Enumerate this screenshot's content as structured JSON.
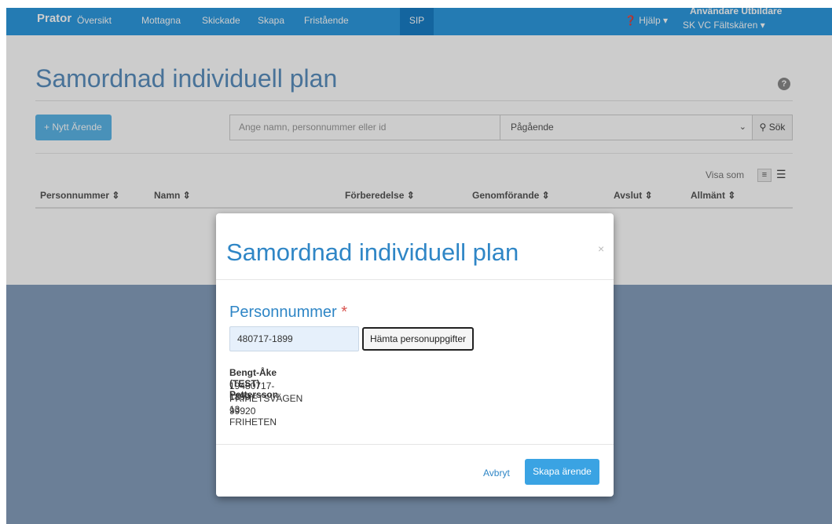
{
  "navbar": {
    "brand": "Prator",
    "items": [
      "Översikt",
      "Mottagna",
      "Skickade",
      "Skapa",
      "Fristående"
    ],
    "active": "SIP",
    "help": "❓ Hjälp ▾",
    "user_role": "Användare Utbildare",
    "user_unit": "SK VC Fältskären ▾"
  },
  "page": {
    "title": "Samordnad individuell plan",
    "help_icon": "?",
    "new_button": "+ Nytt Ärende",
    "search_placeholder": "Ange namn, personnummer eller id",
    "status_selected": "Pågående",
    "search_button": "Sök",
    "view_as": "Visa som",
    "columns": [
      "Personnummer ⇕",
      "Namn ⇕",
      "Förberedelse ⇕",
      "Genomförande ⇕",
      "Avslut ⇕",
      "Allmänt ⇕"
    ]
  },
  "modal": {
    "title": "Samordnad individuell plan",
    "close": "×",
    "field_label": "Personnummer",
    "required_mark": "*",
    "personnummer_value": "480717-1899",
    "fetch_button": "Hämta personuppgifter",
    "person": {
      "name": "Bengt-Åke (TEST) Pettersson",
      "id": "19480717-1899",
      "street": "FRIHETSVÄGEN 13",
      "postal": "99920 FRIHETEN"
    },
    "cancel": "Avbryt",
    "create": "Skapa ärende"
  },
  "colors": {
    "navbar": "#2d9ae0",
    "nav_active": "#1a7fc7",
    "title_blue": "#2f86c6",
    "primary_button": "#3aa3e3",
    "overlay_bottom": "#6b7f97"
  }
}
